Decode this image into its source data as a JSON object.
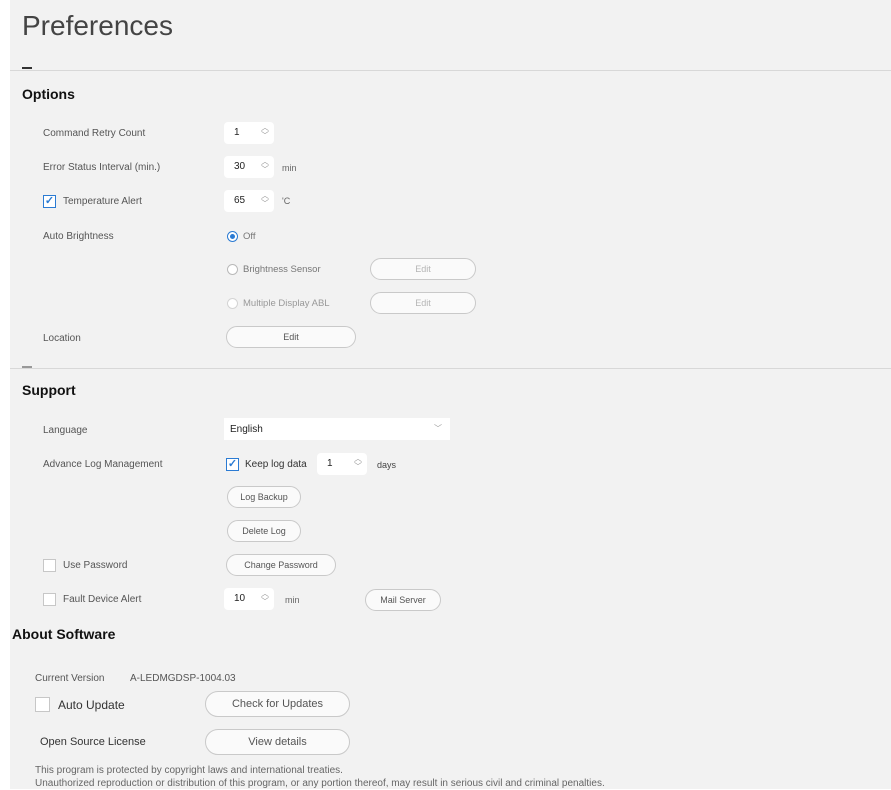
{
  "page_title": "Preferences",
  "options": {
    "section_title": "Options",
    "command_retry_count": {
      "label": "Command Retry Count",
      "value": "1"
    },
    "error_status_interval": {
      "label": "Error Status Interval (min.)",
      "value": "30",
      "unit": "min"
    },
    "temperature_alert": {
      "label": "Temperature Alert",
      "checked": true,
      "value": "65",
      "unit": "'C"
    },
    "auto_brightness": {
      "label": "Auto Brightness",
      "options": [
        {
          "label": "Off",
          "selected": true
        },
        {
          "label": "Brightness Sensor",
          "selected": false,
          "edit_label": "Edit"
        },
        {
          "label": "Multiple Display ABL",
          "selected": false,
          "edit_label": "Edit"
        }
      ]
    },
    "location": {
      "label": "Location",
      "edit_label": "Edit"
    }
  },
  "support": {
    "section_title": "Support",
    "language": {
      "label": "Language",
      "value": "English"
    },
    "advance_log": {
      "label": "Advance Log Management",
      "keep_log_label": "Keep log data",
      "keep_log_checked": true,
      "days_value": "1",
      "days_unit": "days",
      "log_backup_label": "Log Backup",
      "delete_log_label": "Delete Log"
    },
    "use_password": {
      "label": "Use Password",
      "checked": false,
      "button_label": "Change Password"
    },
    "fault_device_alert": {
      "label": "Fault Device Alert",
      "checked": false,
      "value": "10",
      "unit": "min",
      "mail_server_label": "Mail Server"
    }
  },
  "about": {
    "section_title": "About Software",
    "current_version_label": "Current Version",
    "current_version_value": "A-LEDMGDSP-1004.03",
    "auto_update_label": "Auto Update",
    "auto_update_checked": false,
    "check_updates_label": "Check for Updates",
    "open_source_label": "Open Source License",
    "view_details_label": "View details",
    "legal_line1": "This program is protected by copyright laws and international treaties.",
    "legal_line2": "Unauthorized reproduction or distribution of this program, or any portion thereof, may result in serious civil and criminal penalties."
  },
  "colors": {
    "accent": "#2b7bd3",
    "panel_bg": "#f2f2f2"
  }
}
